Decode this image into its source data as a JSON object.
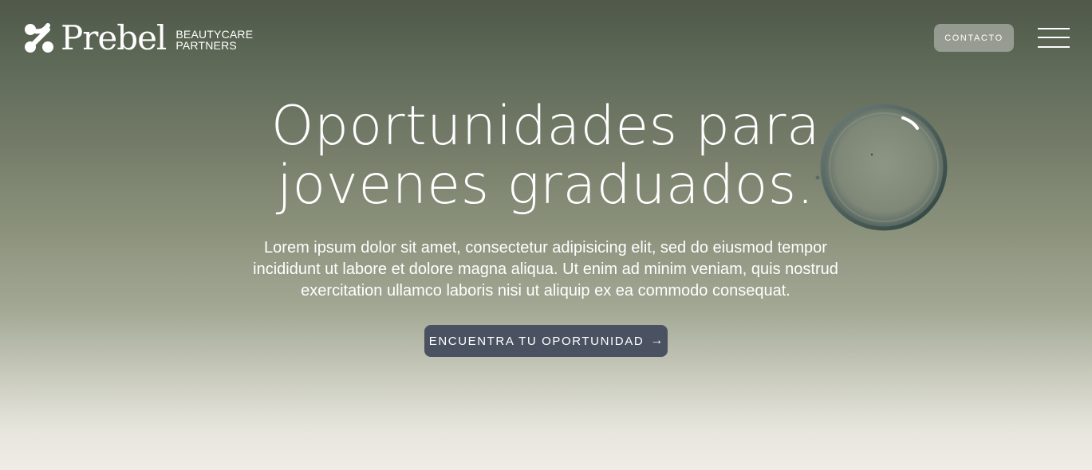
{
  "header": {
    "logo_word": "Prebel",
    "logo_sub_line1": "BEAUTYCARE",
    "logo_sub_line2": "PARTNERS",
    "contact_label": "CONTACTO",
    "menu_icon": "hamburger-menu-icon"
  },
  "hero": {
    "headline_line1": "Oportunidades para",
    "headline_line2": "jovenes graduados.",
    "desc_line1": "Lorem ipsum dolor sit amet, consectetur adipisicing elit, sed do eiusmod tempor",
    "desc_line2": "incididunt ut labore et dolore magna aliqua. Ut enim ad minim veniam, quis nostrud",
    "desc_line3": "exercitation ullamco laboris nisi ut aliquip ex ea commodo consequat.",
    "cta_label": "ENCUENTRA TU OPORTUNIDAD",
    "cta_icon": "arrow-right-icon",
    "decoration": "water-droplet"
  },
  "colors": {
    "cta_bg": "#4a5262",
    "contact_bg": "#c8cac4",
    "bg_top": "#4f5849",
    "bg_bottom": "#efece6"
  }
}
